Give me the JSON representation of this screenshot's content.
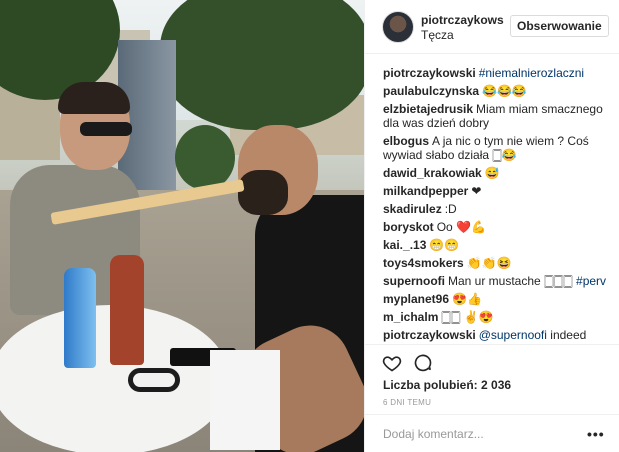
{
  "post": {
    "username": "piotrczaykows",
    "location": "Tęcza",
    "follow_label": "Obserwowanie"
  },
  "comments": [
    {
      "user": "piotrczaykowski",
      "text": "",
      "tag": "#niemalnierozlaczni"
    },
    {
      "user": "paulabulczynska",
      "text": "😂😂😂",
      "tag": ""
    },
    {
      "user": "elzbietajedrusik",
      "text": "Miam miam smacznego dla was dzień dobry",
      "tag": ""
    },
    {
      "user": "elbogus",
      "text": "A ja nic o tym nie wiem ? Coś wywiad słabo działa 🀆😂",
      "tag": ""
    },
    {
      "user": "dawid_krakowiak",
      "text": "😅",
      "tag": ""
    },
    {
      "user": "milkandpepper",
      "text": "❤",
      "tag": ""
    },
    {
      "user": "skadirulez",
      "text": ":D",
      "tag": ""
    },
    {
      "user": "boryskot",
      "text": "Oo ❤️💪",
      "tag": ""
    },
    {
      "user": "kai._.13",
      "text": "😁😁",
      "tag": ""
    },
    {
      "user": "toys4smokers",
      "text": "👏👏😆",
      "tag": ""
    },
    {
      "user": "supernoofi",
      "text": "Man ur mustache 🀆🀆🀆",
      "tag": "#perv"
    },
    {
      "user": "myplanet96",
      "text": "😍👍",
      "tag": ""
    },
    {
      "user": "m_ichalm",
      "text": "🀆🀆 ✌️😍",
      "tag": ""
    },
    {
      "user": "piotrczaykowski",
      "text": "indeed",
      "tag": "@supernoofi"
    }
  ],
  "likes": {
    "label": "Liczba polubień:",
    "count": "2 036"
  },
  "time_ago": "6 DNI TEMU",
  "add_comment": {
    "placeholder": "Dodaj komentarz..."
  },
  "more_icon": "more-icon",
  "colors": {
    "link": "#003569",
    "border": "#efefef",
    "muted": "#999999"
  }
}
